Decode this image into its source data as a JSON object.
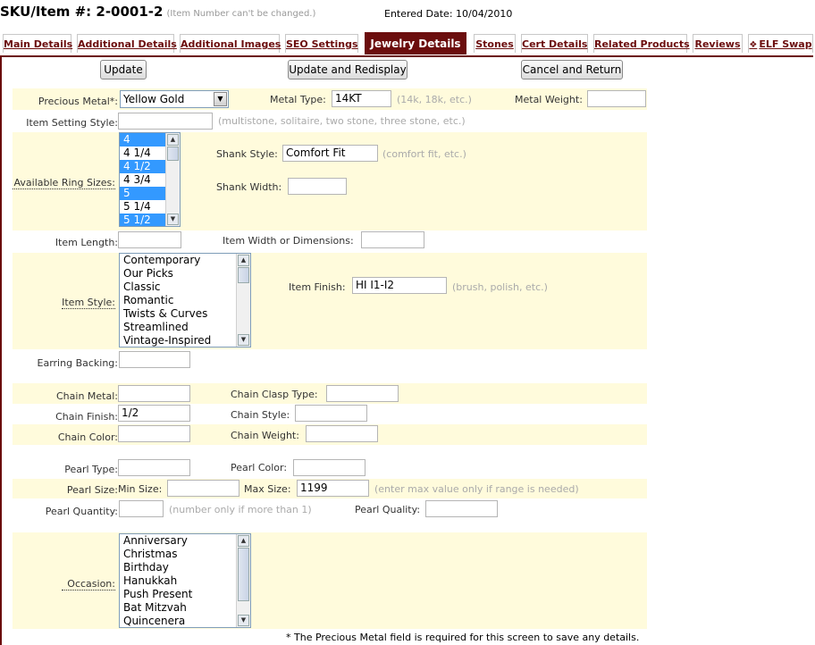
{
  "header": {
    "sku_title": "SKU/Item #: 2-0001-2",
    "sku_note": "(Item Number can't be changed.)",
    "entered_label": "Entered Date:",
    "entered_date": "10/04/2010"
  },
  "tabs": [
    {
      "label": "Main Details"
    },
    {
      "label": "Additional Details"
    },
    {
      "label": "Additional Images"
    },
    {
      "label": "SEO Settings"
    },
    {
      "label": "Jewelry Details"
    },
    {
      "label": "Stones"
    },
    {
      "label": "Cert Details"
    },
    {
      "label": "Related Products"
    },
    {
      "label": "Reviews"
    },
    {
      "label": "ELF Swap"
    }
  ],
  "buttons": {
    "update": "Update",
    "update_redisplay": "Update and Redisplay",
    "cancel_return": "Cancel and Return"
  },
  "form": {
    "precious_metal": {
      "label": "Precious Metal*:",
      "value": "Yellow Gold"
    },
    "metal_type": {
      "label": "Metal Type:",
      "value": "14KT",
      "hint": "(14k, 18k, etc.)"
    },
    "metal_weight": {
      "label": "Metal Weight:",
      "value": ""
    },
    "setting_style": {
      "label": "Item Setting Style:",
      "value": "",
      "hint": "(multistone, solitaire, two stone, three stone, etc.)"
    },
    "ring_sizes": {
      "label": "Available Ring Sizes:",
      "options": [
        {
          "text": "4",
          "selected": true
        },
        {
          "text": "4 1/4",
          "selected": false
        },
        {
          "text": "4 1/2",
          "selected": true
        },
        {
          "text": "4 3/4",
          "selected": false
        },
        {
          "text": "5",
          "selected": true
        },
        {
          "text": "5 1/4",
          "selected": false
        },
        {
          "text": "5 1/2",
          "selected": true
        }
      ]
    },
    "shank_style": {
      "label": "Shank Style:",
      "value": "Comfort Fit",
      "hint": "(comfort fit, etc.)"
    },
    "shank_width": {
      "label": "Shank Width:",
      "value": ""
    },
    "item_length": {
      "label": "Item Length:",
      "value": ""
    },
    "item_width": {
      "label": "Item Width or Dimensions:",
      "value": ""
    },
    "item_style": {
      "label": "Item Style:",
      "options": [
        "Contemporary",
        "Our Picks",
        "Classic",
        "Romantic",
        "Twists & Curves",
        "Streamlined",
        "Vintage-Inspired"
      ]
    },
    "item_finish": {
      "label": "Item Finish:",
      "value": "HI I1-I2",
      "hint": "(brush, polish, etc.)"
    },
    "earring_backing": {
      "label": "Earring Backing:",
      "value": ""
    },
    "chain_metal": {
      "label": "Chain Metal:",
      "value": ""
    },
    "chain_clasp": {
      "label": "Chain Clasp Type:",
      "value": ""
    },
    "chain_finish": {
      "label": "Chain Finish:",
      "value": "1/2"
    },
    "chain_style": {
      "label": "Chain Style:",
      "value": ""
    },
    "chain_color": {
      "label": "Chain Color:",
      "value": ""
    },
    "chain_weight": {
      "label": "Chain Weight:",
      "value": ""
    },
    "pearl_type": {
      "label": "Pearl Type:",
      "value": ""
    },
    "pearl_color": {
      "label": "Pearl Color:",
      "value": ""
    },
    "pearl_size": {
      "label": "Pearl Size:",
      "min_label": "Min Size:",
      "min_value": "",
      "max_label": "Max Size:",
      "max_value": "1199",
      "hint": "(enter max value only if range is needed)"
    },
    "pearl_quantity": {
      "label": "Pearl Quantity:",
      "value": "",
      "hint": "(number only if more than 1)"
    },
    "pearl_quality": {
      "label": "Pearl Quality:",
      "value": ""
    },
    "occasion": {
      "label": "Occasion:",
      "options": [
        "Anniversary",
        "Christmas",
        "Birthday",
        "Hanukkah",
        "Push Present",
        "Bat Mitzvah",
        "Quincenera"
      ]
    }
  },
  "footnote": "* The Precious Metal field is required for this screen to save any details.",
  "colors": {
    "accent": "#6b0d0d",
    "band": "#fffbdc",
    "selection": "#3399ff"
  }
}
